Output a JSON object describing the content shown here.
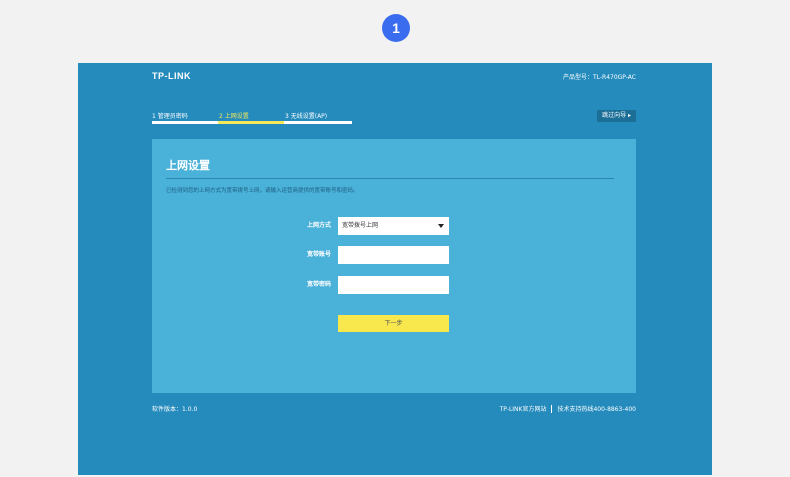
{
  "step_badge": "1",
  "header": {
    "logo": "TP-LINK",
    "model": "产品型号：TL-R470GP-AC"
  },
  "steps": [
    {
      "label": "1 管理员密码",
      "active": false
    },
    {
      "label": "2 上网设置",
      "active": true
    },
    {
      "label": "3 无线设置(AP)",
      "active": false
    }
  ],
  "skip_button": "跳过向导 ▸",
  "panel": {
    "title": "上网设置",
    "description": "已检测到您的上网方式为宽带拨号上网，请输入运营商提供的宽带账号和密码。",
    "form": {
      "mode_label": "上网方式",
      "mode_value": "宽带拨号上网",
      "account_label": "宽带账号",
      "account_value": "",
      "password_label": "宽带密码",
      "password_value": ""
    },
    "next_button": "下一步"
  },
  "footer": {
    "version": "软件版本：1.0.0",
    "site": "TP-LINK官方网站",
    "hotline": "技术支持热线400-8863-400"
  }
}
